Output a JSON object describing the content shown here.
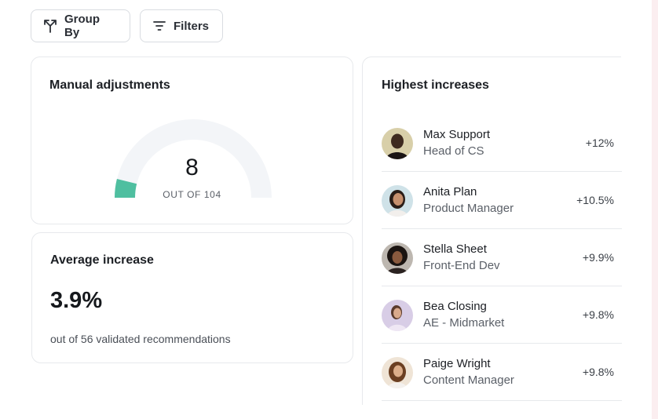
{
  "toolbar": {
    "group_by_label": "Group By",
    "filters_label": "Filters",
    "group_by_icon": "split-arrows-icon",
    "filters_icon": "filter-lines-icon"
  },
  "manual_adjustments": {
    "title": "Manual adjustments",
    "value": "8",
    "out_of": "OUT OF 104",
    "progress_fraction": 0.077,
    "fill_color": "#4fbfa0",
    "track_color": "#f3f5f8"
  },
  "average_increase": {
    "title": "Average increase",
    "value": "3.9%",
    "sub": "out of 56 validated recommendations"
  },
  "highest_increases": {
    "title": "Highest increases",
    "people": [
      {
        "name": "Max Support",
        "role": "Head of CS",
        "increase": "+12%"
      },
      {
        "name": "Anita Plan",
        "role": "Product Manager",
        "increase": "+10.5%"
      },
      {
        "name": "Stella Sheet",
        "role": "Front-End Dev",
        "increase": "+9.9%"
      },
      {
        "name": "Bea Closing",
        "role": "AE - Midmarket",
        "increase": "+9.8%"
      },
      {
        "name": "Paige Wright",
        "role": "Content Manager",
        "increase": "+9.8%"
      }
    ]
  }
}
